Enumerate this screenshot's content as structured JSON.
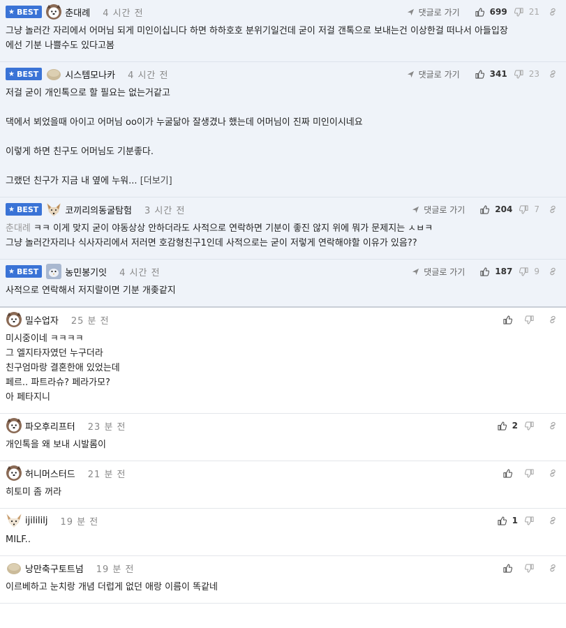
{
  "reply_label": "댓글로 가기",
  "more_label": "[더보기]",
  "best_label": "BEST",
  "comments": [
    {
      "best": true,
      "avatar": "dog",
      "author": "춘대례",
      "time": "4 시간 전",
      "up": "699",
      "down": "21",
      "lines": [
        "그냥 놀러간 자리에서 어머님 되게 미인이십니다 하면 하하호호 분위기일건데 굳이 저걸 갠톡으로 보내는건 이상한걸 떠나서 아들입장",
        "에선 기분 나쁠수도 있다고봄"
      ]
    },
    {
      "best": true,
      "avatar": "bread",
      "author": "시스템모나카",
      "time": "4 시간 전",
      "up": "341",
      "down": "23",
      "lines": [
        "저걸 굳이 개인톡으로 할 필요는 없는거같고",
        "",
        "댁에서 뵈었을때 아이고 어머님 oo이가 누굴닮아 잘생겼나 했는데 어머님이 진짜 미인이시네요",
        "",
        "이렇게 하면 친구도 어머님도 기분좋다.",
        "",
        "그랬던 친구가 지금 내 옆에 누워..."
      ],
      "more": true
    },
    {
      "best": true,
      "avatar": "fox",
      "author": "코끼리의동굴탐험",
      "time": "3 시간 전",
      "up": "204",
      "down": "7",
      "mention": "춘대례",
      "lines": [
        "ㅋㅋ 이게 맞지 굳이 야동상상 안하더라도 사적으로 연락하면 기분이 좋진 않지 위에 뭐가 문제지는 ㅅㅂㅋ",
        "그냥 놀러간자리나 식사자리에서 저러면 호감형친구1인데 사적으로는 굳이 저렇게 연락해야할 이유가 있음??"
      ]
    },
    {
      "best": true,
      "avatar": "bird",
      "author": "농민봉기잇",
      "time": "4 시간 전",
      "up": "187",
      "down": "9",
      "lines": [
        "사적으로 연락해서 저지랄이면 기분 개좆같지"
      ]
    },
    {
      "best": false,
      "avatar": "dog",
      "author": "밀수업자",
      "time": "25 분 전",
      "up": "",
      "down": "",
      "lines": [
        "미시중이네 ㅋㅋㅋㅋ",
        "그 엘지타자였던 누구더라",
        "친구엄마랑 결혼한애 있었는데",
        "페르.. 파트라슈? 페라가모?",
        "아 페타지니"
      ]
    },
    {
      "best": false,
      "avatar": "dog",
      "author": "파오후리프터",
      "time": "23 분 전",
      "up": "2",
      "down": "",
      "lines": [
        "개인톡을 왜 보내 시발롬이"
      ]
    },
    {
      "best": false,
      "avatar": "dog",
      "author": "허니머스터드",
      "time": "21 분 전",
      "up": "",
      "down": "",
      "lines": [
        "히토미 좀 꺼라"
      ]
    },
    {
      "best": false,
      "avatar": "chihuahua",
      "author": "ijilililj",
      "time": "19 분 전",
      "up": "1",
      "down": "",
      "lines": [
        "MILF.."
      ]
    },
    {
      "best": false,
      "avatar": "bread",
      "author": "낭만축구토트넘",
      "time": "19 분 전",
      "up": "",
      "down": "",
      "lines": [
        "이르베하고 눈치랑 개념 더럽게 없던 애랑 이름이 똑같네"
      ]
    }
  ],
  "colors": {
    "badge": "#3a73d6",
    "best_bg": "#eff3f9",
    "divider": "#e3e6ea"
  },
  "icons": [
    "star-icon",
    "reply-arrow-icon",
    "thumbs-up-icon",
    "thumbs-down-icon",
    "link-icon",
    "avatar-icon"
  ]
}
